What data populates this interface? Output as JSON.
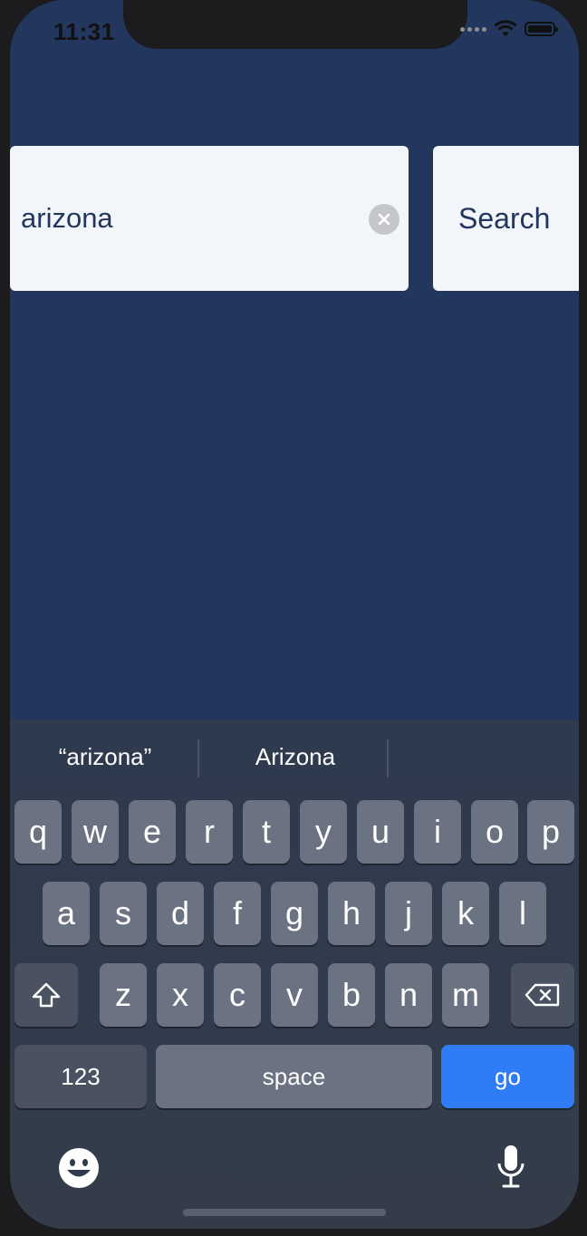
{
  "status_bar": {
    "time": "11:31"
  },
  "search": {
    "value": "arizona",
    "button_label": "Search"
  },
  "keyboard": {
    "suggestions": [
      "“arizona”",
      "Arizona"
    ],
    "row1": [
      "q",
      "w",
      "e",
      "r",
      "t",
      "y",
      "u",
      "i",
      "o",
      "p"
    ],
    "row2": [
      "a",
      "s",
      "d",
      "f",
      "g",
      "h",
      "j",
      "k",
      "l"
    ],
    "row3": [
      "z",
      "x",
      "c",
      "v",
      "b",
      "n",
      "m"
    ],
    "numbers_label": "123",
    "space_label": "space",
    "go_label": "go"
  },
  "icons": [
    "wifi-icon",
    "battery-icon",
    "clear-icon",
    "shift-icon",
    "backspace-icon",
    "emoji-icon",
    "microphone-icon"
  ],
  "colors": {
    "background": "#22365e",
    "field": "#f2f5fa",
    "go_key": "#2f7cf6"
  }
}
